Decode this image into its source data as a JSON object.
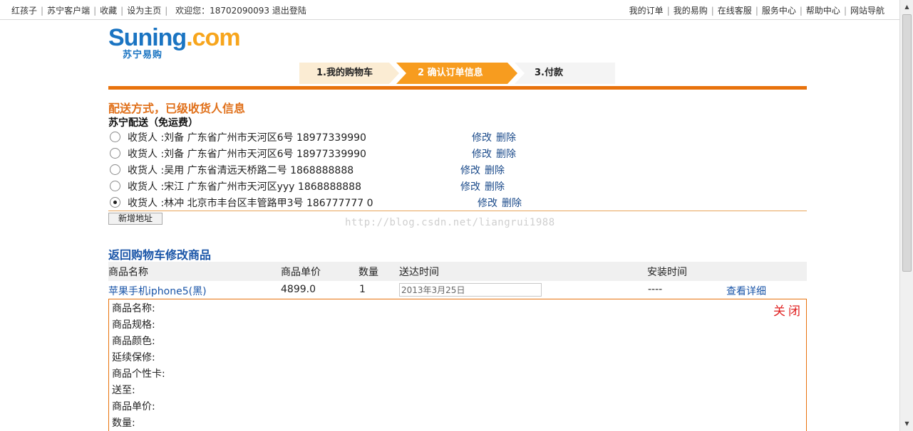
{
  "topbar": {
    "left_links": [
      "红孩子",
      "苏宁客户端",
      "收藏",
      "设为主页"
    ],
    "welcome_label": "欢迎您：18702090093",
    "logout": "退出登陆",
    "right_links": [
      "我的订单",
      "我的易购",
      "在线客服",
      "服务中心",
      "帮助中心",
      "网站导航"
    ]
  },
  "logo": {
    "main_blue": "Suning",
    "main_orange": ".com",
    "sub": "苏宁易购"
  },
  "steps": [
    "1.我的购物车",
    "2 确认订单信息",
    "3.付款"
  ],
  "shipping": {
    "heading": "配送方式，已级收货人信息",
    "method": "苏宁配送（免运费）",
    "addresses": [
      {
        "text": "收货人 :刘备  广东省广州市天河区6号    18977339990",
        "edit": "修改",
        "delete": "删除",
        "selected": false
      },
      {
        "text": "收货人 :刘备  广东省广州市天河区6号    18977339990",
        "edit": "修改",
        "delete": "删除",
        "selected": false
      },
      {
        "text": "收货人 :吴用  广东省清远天桥路二号    1868888888",
        "edit": "修改",
        "delete": "删除",
        "selected": false
      },
      {
        "text": "收货人 :宋江  广东省广州市天河区yyy    1868888888",
        "edit": "修改",
        "delete": "删除",
        "selected": false
      },
      {
        "text": "收货人 :林冲  北京市丰台区丰管路甲3号    186777777   0",
        "edit": "修改",
        "delete": "删除",
        "selected": true
      }
    ],
    "add_address": "新增地址"
  },
  "watermark": "http://blog.csdn.net/liangrui1988",
  "cart": {
    "back_link": "返回购物车修改商品",
    "headers": [
      "商品名称",
      "商品单价",
      "数量",
      "送达时间",
      "安装时间"
    ],
    "row": {
      "name": "苹果手机iphone5(黑)",
      "price": "4899.0",
      "qty": "1",
      "delivery": "2013年3月25日",
      "install": "----",
      "detail": "查看详细"
    }
  },
  "detail": {
    "close": "关闭",
    "labels": [
      "商品名称:",
      "商品规格:",
      "商品颜色:",
      "延续保修:",
      "商品个性卡:",
      "送至:",
      "商品单价:",
      "数量:"
    ]
  },
  "colors": {
    "accent_orange": "#e8720c",
    "link_blue": "#1a55a8",
    "step_active": "#f79c1f"
  }
}
